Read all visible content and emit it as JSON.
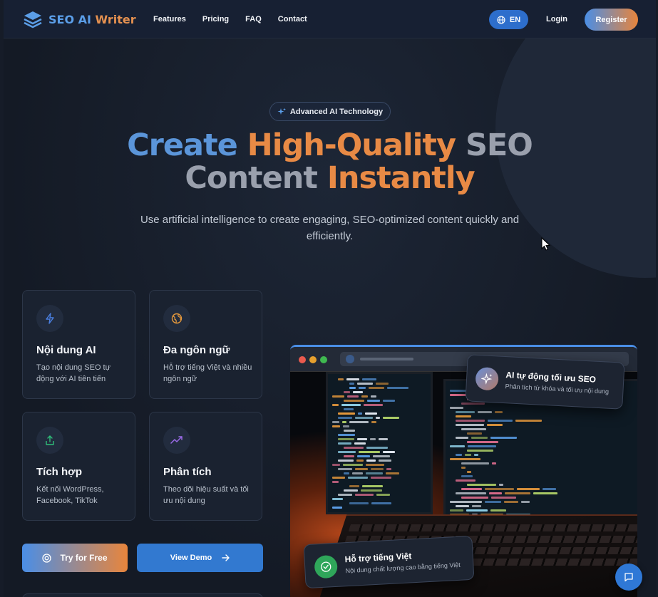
{
  "nav": {
    "logo_part1": "SEO AI ",
    "logo_part2": "Writer",
    "links": [
      "Features",
      "Pricing",
      "FAQ",
      "Contact"
    ],
    "lang": "EN",
    "login": "Login",
    "register": "Register"
  },
  "hero": {
    "badge": "Advanced AI Technology",
    "headline_1": "Create ",
    "headline_2": "High-Quality",
    "headline_3": " SEO",
    "headline_4": "Content ",
    "headline_5": "Instantly",
    "subtitle": "Use artificial intelligence to create engaging, SEO-optimized content quickly and efficiently."
  },
  "features": [
    {
      "icon": "lightning-icon",
      "title": "Nội dung AI",
      "desc": "Tạo nội dung SEO tự động với AI tiên tiến",
      "color": "#4a7fe0"
    },
    {
      "icon": "globe-icon",
      "title": "Đa ngôn ngữ",
      "desc": "Hỗ trợ tiếng Việt và nhiều ngôn ngữ",
      "color": "#e89a3c"
    },
    {
      "icon": "share-icon",
      "title": "Tích hợp",
      "desc": "Kết nối WordPress, Facebook, TikTok",
      "color": "#2fbf7a"
    },
    {
      "icon": "trending-up-icon",
      "title": "Phân tích",
      "desc": "Theo dõi hiệu suất và tối ưu nội dung",
      "color": "#9b6be8"
    }
  ],
  "cta": {
    "try_free": "Try for Free",
    "view_demo": "View Demo"
  },
  "toasts": {
    "top_title": "AI tự động tối ưu SEO",
    "top_sub": "Phân tích từ khóa và tối ưu nội dung",
    "bottom_title": "Hỗ trợ tiếng Việt",
    "bottom_sub": "Nội dung chất lượng cao bằng tiếng Việt"
  },
  "colors": {
    "accent_blue": "#4a8ee6",
    "accent_orange": "#e8853c",
    "background": "#161c28"
  }
}
